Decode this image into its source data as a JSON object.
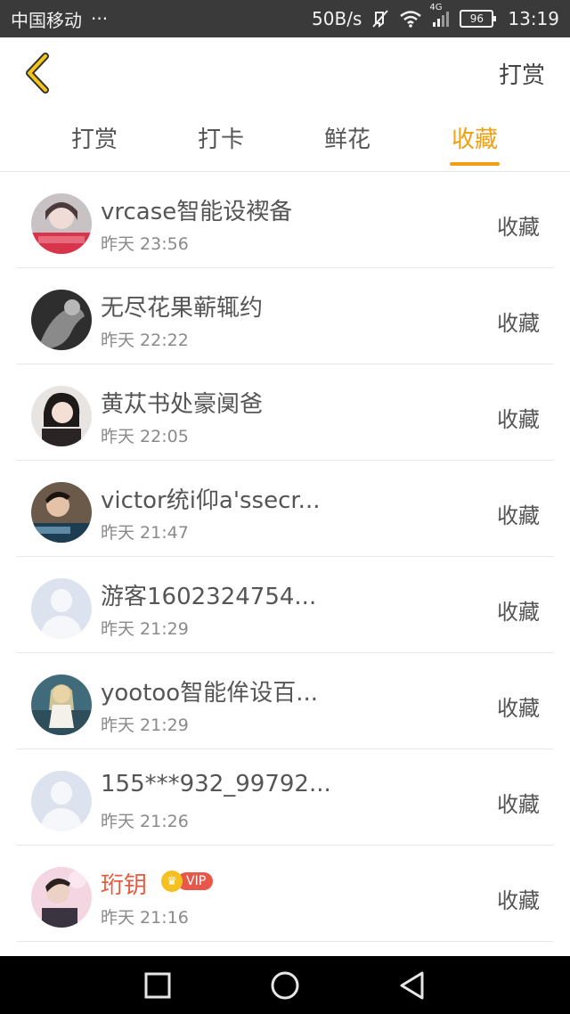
{
  "status_bar": {
    "carrier": "中国移动",
    "dots": "···",
    "net_speed": "50B/s",
    "network_type": "4G",
    "battery": "96",
    "time": "13:19",
    "icons": [
      "mute-icon",
      "wifi-icon",
      "signal-icon",
      "battery-icon"
    ]
  },
  "header": {
    "back_icon": "chevron-left-icon",
    "action_label": "打赏",
    "accent_color": "#f0a010"
  },
  "tabs": [
    {
      "label": "打赏",
      "active": false
    },
    {
      "label": "打卡",
      "active": false
    },
    {
      "label": "鲜花",
      "active": false
    },
    {
      "label": "收藏",
      "active": true
    }
  ],
  "list": [
    {
      "name": "vrcase智能设褉备",
      "time": "昨天 23:56",
      "action": "收藏",
      "avatar": "photo"
    },
    {
      "name": "无尽花果蕲辄约",
      "time": "昨天 22:22",
      "action": "收藏",
      "avatar": "photo"
    },
    {
      "name": "黄苁书处豪阒爸",
      "time": "昨天 22:05",
      "action": "收藏",
      "avatar": "photo"
    },
    {
      "name": "victor统i仰a'ssecr...",
      "time": "昨天 21:47",
      "action": "收藏",
      "avatar": "photo"
    },
    {
      "name": "游客1602324754...",
      "time": "昨天 21:29",
      "action": "收藏",
      "avatar": "placeholder"
    },
    {
      "name": "yootoo智能侔设百...",
      "time": "昨天 21:29",
      "action": "收藏",
      "avatar": "photo"
    },
    {
      "name": "155***932_99792...",
      "time": "昨天 21:26",
      "action": "收藏",
      "avatar": "placeholder"
    },
    {
      "name": "珩钥",
      "time": "昨天 21:16",
      "action": "收藏",
      "avatar": "photo",
      "vip": "VIP"
    }
  ],
  "nav_bar": {
    "icons": [
      "recent-apps-icon",
      "home-icon",
      "back-triangle-icon"
    ]
  }
}
